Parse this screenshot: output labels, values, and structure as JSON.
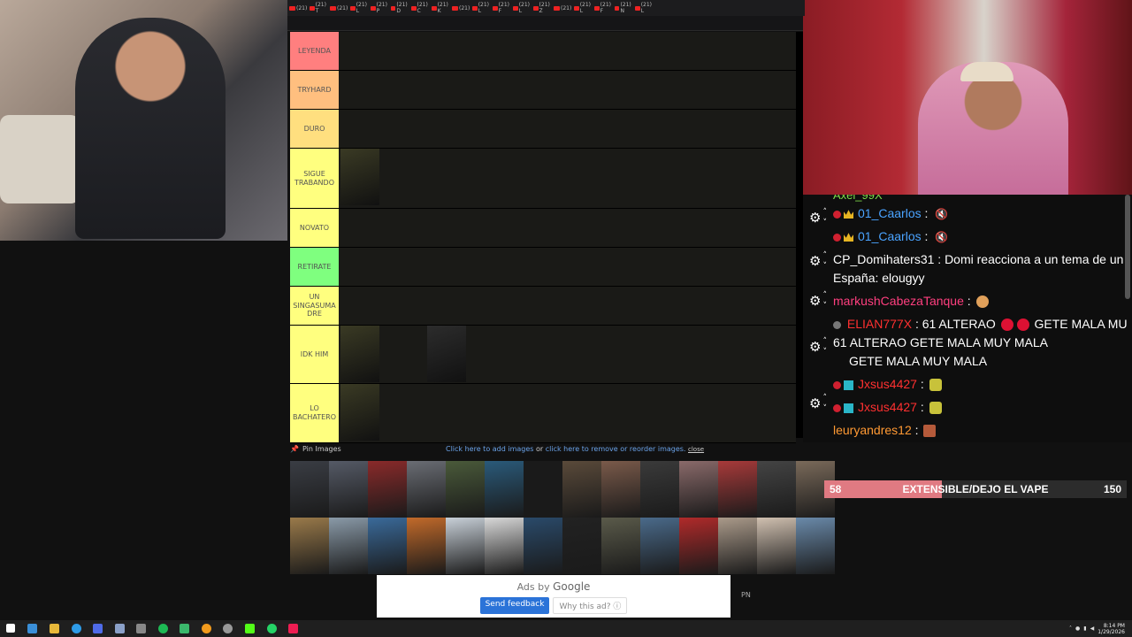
{
  "tabs": [
    "(21)",
    "(21) T",
    "(21)",
    "(21) L",
    "(21) P",
    "(21) D",
    "(21) C",
    "(21) K",
    "(21)",
    "(21) L",
    "(21) F",
    "(21) L",
    "(21) Z",
    "(21)",
    "(21) L",
    "(21) F",
    "(21) N",
    "(21) L"
  ],
  "tiers": [
    {
      "label": "LEYENDA",
      "color": "#ff7f7f",
      "items": 0
    },
    {
      "label": "TRYHARD",
      "color": "#ffbf7f",
      "items": 0
    },
    {
      "label": "DURO",
      "color": "#ffdf7f",
      "items": 0
    },
    {
      "label": "SIGUE TRABANDO",
      "color": "#ffff7f",
      "items": 1
    },
    {
      "label": "NOVATO",
      "color": "#ffff7f",
      "items": 0
    },
    {
      "label": "RETIRATE",
      "color": "#7fff7f",
      "items": 0
    },
    {
      "label": "UN SINGASUMA DRE",
      "color": "#ffff7f",
      "items": 0
    },
    {
      "label": "IDK HIM",
      "color": "#ffff7f",
      "items": 2
    },
    {
      "label": "LO BACHATERO",
      "color": "#ffff7f",
      "items": 1
    }
  ],
  "chat": [
    {
      "user": "01_Caarlos",
      "color": "#4aa3ff",
      "text": "",
      "badges": "crown"
    },
    {
      "user": "01_Caarlos",
      "color": "#4aa3ff",
      "text": "",
      "badges": "crown"
    },
    {
      "user": "CP_Domihaters31",
      "color": "#ffffff",
      "text": "Domi reacciona a un tema de un",
      "line2": "España: elougyy"
    },
    {
      "user": "markushCabezaTanque",
      "color": "#ff3f7f",
      "text": ""
    },
    {
      "user": "ELIAN777X",
      "color": "#ff3030",
      "text": "61 ALTERAO",
      "line2": "61 ALTERAO GETE MALA MUY MALA",
      "line3": "GETE MALA MUY MALA",
      "tail": "GETE MALA MU"
    },
    {
      "user": "Jxsus4427",
      "color": "#ff3030",
      "text": "",
      "badges": "sq"
    },
    {
      "user": "Jxsus4427",
      "color": "#ff3030",
      "text": "",
      "badges": "sq"
    },
    {
      "user": "leuryandres12",
      "color": "#ff9933",
      "text": ""
    }
  ],
  "pin": {
    "label": "Pin Images",
    "add_link": "Click here to add images",
    "or": "or",
    "remove_link": "click here to remove or reorder images.",
    "close": "close"
  },
  "goal": {
    "current": "58",
    "title": "EXTENSIBLE/DEJO EL VAPE",
    "target": "150",
    "progress": 0.39
  },
  "ad": {
    "ads_by": "Ads by",
    "google": "Google",
    "send_feedback": "Send feedback",
    "why": "Why this ad?"
  },
  "pn": "PN",
  "clock": {
    "time": "8:14 PM",
    "date": "1/29/2026"
  },
  "partial_user": "Axel_99X"
}
